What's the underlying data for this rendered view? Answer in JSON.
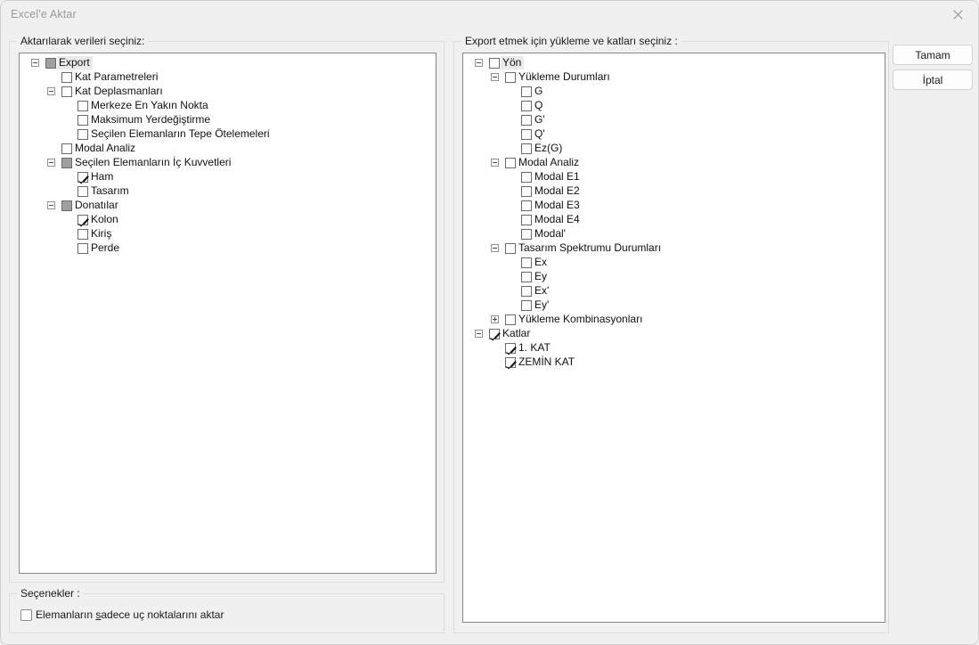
{
  "window": {
    "title": "Excel'e Aktar",
    "close_icon": "close-icon"
  },
  "left_group": {
    "legend": "Aktarılarak verileri seçiniz:",
    "tree": [
      {
        "label": "Export",
        "indent": 0,
        "state": "indeterminate",
        "expander": "minus",
        "selected": true
      },
      {
        "label": "Kat Parametreleri",
        "indent": 1,
        "state": "unchecked",
        "expander": "none",
        "selected": false
      },
      {
        "label": "Kat Deplasmanları",
        "indent": 1,
        "state": "unchecked",
        "expander": "minus",
        "selected": false
      },
      {
        "label": "Merkeze En Yakın Nokta",
        "indent": 2,
        "state": "unchecked",
        "expander": "none",
        "selected": false
      },
      {
        "label": "Maksimum Yerdeğiştirme",
        "indent": 2,
        "state": "unchecked",
        "expander": "none",
        "selected": false
      },
      {
        "label": "Seçilen Elemanların Tepe Ötelemeleri",
        "indent": 2,
        "state": "unchecked",
        "expander": "none",
        "selected": false
      },
      {
        "label": "Modal Analiz",
        "indent": 1,
        "state": "unchecked",
        "expander": "none",
        "selected": false
      },
      {
        "label": "Seçilen Elemanların İç Kuvvetleri",
        "indent": 1,
        "state": "indeterminate",
        "expander": "minus",
        "selected": false
      },
      {
        "label": "Ham",
        "indent": 2,
        "state": "checked",
        "expander": "none",
        "selected": false
      },
      {
        "label": "Tasarım",
        "indent": 2,
        "state": "unchecked",
        "expander": "none",
        "selected": false
      },
      {
        "label": "Donatılar",
        "indent": 1,
        "state": "indeterminate",
        "expander": "minus",
        "selected": false
      },
      {
        "label": "Kolon",
        "indent": 2,
        "state": "checked",
        "expander": "none",
        "selected": false
      },
      {
        "label": "Kiriş",
        "indent": 2,
        "state": "unchecked",
        "expander": "none",
        "selected": false
      },
      {
        "label": "Perde",
        "indent": 2,
        "state": "unchecked",
        "expander": "none",
        "selected": false
      }
    ]
  },
  "right_group": {
    "legend": "Export etmek için yükleme ve katları seçiniz :",
    "tree": [
      {
        "label": "Yön",
        "indent": 0,
        "state": "unchecked",
        "expander": "minus",
        "selected": true
      },
      {
        "label": "Yükleme Durumları",
        "indent": 1,
        "state": "unchecked",
        "expander": "minus",
        "selected": false
      },
      {
        "label": "G",
        "indent": 2,
        "state": "unchecked",
        "expander": "none",
        "selected": false
      },
      {
        "label": "Q",
        "indent": 2,
        "state": "unchecked",
        "expander": "none",
        "selected": false
      },
      {
        "label": "G'",
        "indent": 2,
        "state": "unchecked",
        "expander": "none",
        "selected": false
      },
      {
        "label": "Q'",
        "indent": 2,
        "state": "unchecked",
        "expander": "none",
        "selected": false
      },
      {
        "label": "Ez(G)",
        "indent": 2,
        "state": "unchecked",
        "expander": "none",
        "selected": false
      },
      {
        "label": "Modal Analiz",
        "indent": 1,
        "state": "unchecked",
        "expander": "minus",
        "selected": false
      },
      {
        "label": "Modal E1",
        "indent": 2,
        "state": "unchecked",
        "expander": "none",
        "selected": false
      },
      {
        "label": "Modal E2",
        "indent": 2,
        "state": "unchecked",
        "expander": "none",
        "selected": false
      },
      {
        "label": "Modal E3",
        "indent": 2,
        "state": "unchecked",
        "expander": "none",
        "selected": false
      },
      {
        "label": "Modal E4",
        "indent": 2,
        "state": "unchecked",
        "expander": "none",
        "selected": false
      },
      {
        "label": "Modal'",
        "indent": 2,
        "state": "unchecked",
        "expander": "none",
        "selected": false
      },
      {
        "label": "Tasarım Spektrumu Durumları",
        "indent": 1,
        "state": "unchecked",
        "expander": "minus",
        "selected": false
      },
      {
        "label": "Ex",
        "indent": 2,
        "state": "unchecked",
        "expander": "none",
        "selected": false
      },
      {
        "label": "Ey",
        "indent": 2,
        "state": "unchecked",
        "expander": "none",
        "selected": false
      },
      {
        "label": "Ex'",
        "indent": 2,
        "state": "unchecked",
        "expander": "none",
        "selected": false
      },
      {
        "label": "Ey'",
        "indent": 2,
        "state": "unchecked",
        "expander": "none",
        "selected": false
      },
      {
        "label": "Yükleme Kombinasyonları",
        "indent": 1,
        "state": "unchecked",
        "expander": "plus",
        "selected": false
      },
      {
        "label": "Katlar",
        "indent": 0,
        "state": "checked",
        "expander": "minus",
        "selected": false
      },
      {
        "label": "1. KAT",
        "indent": 1,
        "state": "checked",
        "expander": "none",
        "selected": false
      },
      {
        "label": "ZEMİN KAT",
        "indent": 1,
        "state": "checked",
        "expander": "none",
        "selected": false
      }
    ]
  },
  "options_group": {
    "legend": "Seçenekler :",
    "checkbox": {
      "label_before": "Elemanların ",
      "accel": "s",
      "label_after": "adece uç noktalarını aktar",
      "checked": false
    }
  },
  "buttons": {
    "ok": "Tamam",
    "cancel": "İptal"
  },
  "colors": {
    "window_bg": "#f0f0f0",
    "panel_bg": "#ffffff",
    "panel_border": "#828790",
    "group_border": "#dcdcdc",
    "title_text": "#9a9a9a",
    "body_text": "#101010",
    "checkbox_indeterminate": "#a0a0a0",
    "selection_bg": "#eaeaea"
  }
}
